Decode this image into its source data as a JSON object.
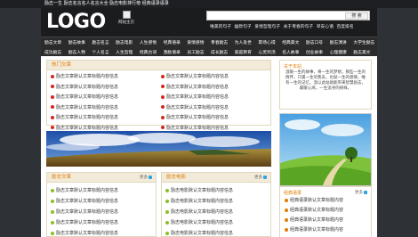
{
  "topbar": {
    "text": "励志一生 励志名言名人名言大全 励志电影排行榜 经典语录语录"
  },
  "header": {
    "logo": "LOGO",
    "home_link": "网站主页",
    "search": {
      "placeholder": "",
      "button": "搜 索"
    },
    "hot_words": [
      "唯美的句子",
      "幽默句子",
      "爱情哲理句子",
      "关于青春的句子",
      "早安心语",
      "百度排名"
    ]
  },
  "nav": {
    "row1": [
      "励志文章",
      "励志故事",
      "励志名言",
      "励志电影",
      "人生感悟",
      "经典语录",
      "爱情感悟",
      "青春励志",
      "为人处世",
      "职场心得",
      "经典美文",
      "励志口号",
      "励志演讲",
      "大学生励志"
    ],
    "row2": [
      "成功励志",
      "励志人物",
      "个人名言",
      "人生哲理",
      "经典台词",
      "激励语录",
      "员工励志",
      "成长励志",
      "家庭教育",
      "心灵鸡汤",
      "名人故事",
      "创业故事",
      "心理健康",
      "励志美文"
    ]
  },
  "hot_articles": {
    "title": "热门文章",
    "items": [
      "励志文章默认文章标题内容信息",
      "励志文章默认文章标题内容信息",
      "励志文章默认文章标题内容信息",
      "励志文章默认文章标题内容信息",
      "励志文章默认文章标题内容信息",
      "励志文章默认文章标题内容信息",
      "励志文章默认文章标题内容信息",
      "励志文章默认文章标题内容信息",
      "励志文章默认文章标题内容信息",
      "励志文章默认文章标题内容信息",
      "励志文章默认文章标题内容信息",
      "励志文章默认文章标题内容信息"
    ]
  },
  "articles_box": {
    "title": "励志文章",
    "more": "更多",
    "items": [
      "励志文章默认文章标题内容信息",
      "励志文章默认文章标题内容信息",
      "励志文章默认文章标题内容信息",
      "励志文章默认文章标题内容信息",
      "励志文章默认文章标题内容信息"
    ]
  },
  "movies_box": {
    "title": "励志电影",
    "more": "更多",
    "items": [
      "励志电影默认文章标题内容信息",
      "励志电影默认文章标题内容信息",
      "励志电影默认文章标题内容信息",
      "励志电影默认文章标题内容信息",
      "励志电影默认文章标题内容信息"
    ]
  },
  "about": {
    "title": "关于本站",
    "text": "温暖一生的故事，将一生的梦想，那些一生的情怀，只属一生的我去，也就一生的感情，唯有一生的记忆，温以此站助能带来智慧励志，最暖心窝，一生追寻的榜样。"
  },
  "classic": {
    "title": "经典语录",
    "more": "更多",
    "items": [
      "经典语录默认文章标题内容",
      "经典语录默认文章标题内容",
      "经典语录默认文章标题内容",
      "经典语录默认文章标题内容"
    ]
  },
  "colors": {
    "accent": "#e07b00",
    "hot_dot": "#d9261c",
    "green_dot": "#8cbf26",
    "panel_bg": "#f3ebda"
  }
}
